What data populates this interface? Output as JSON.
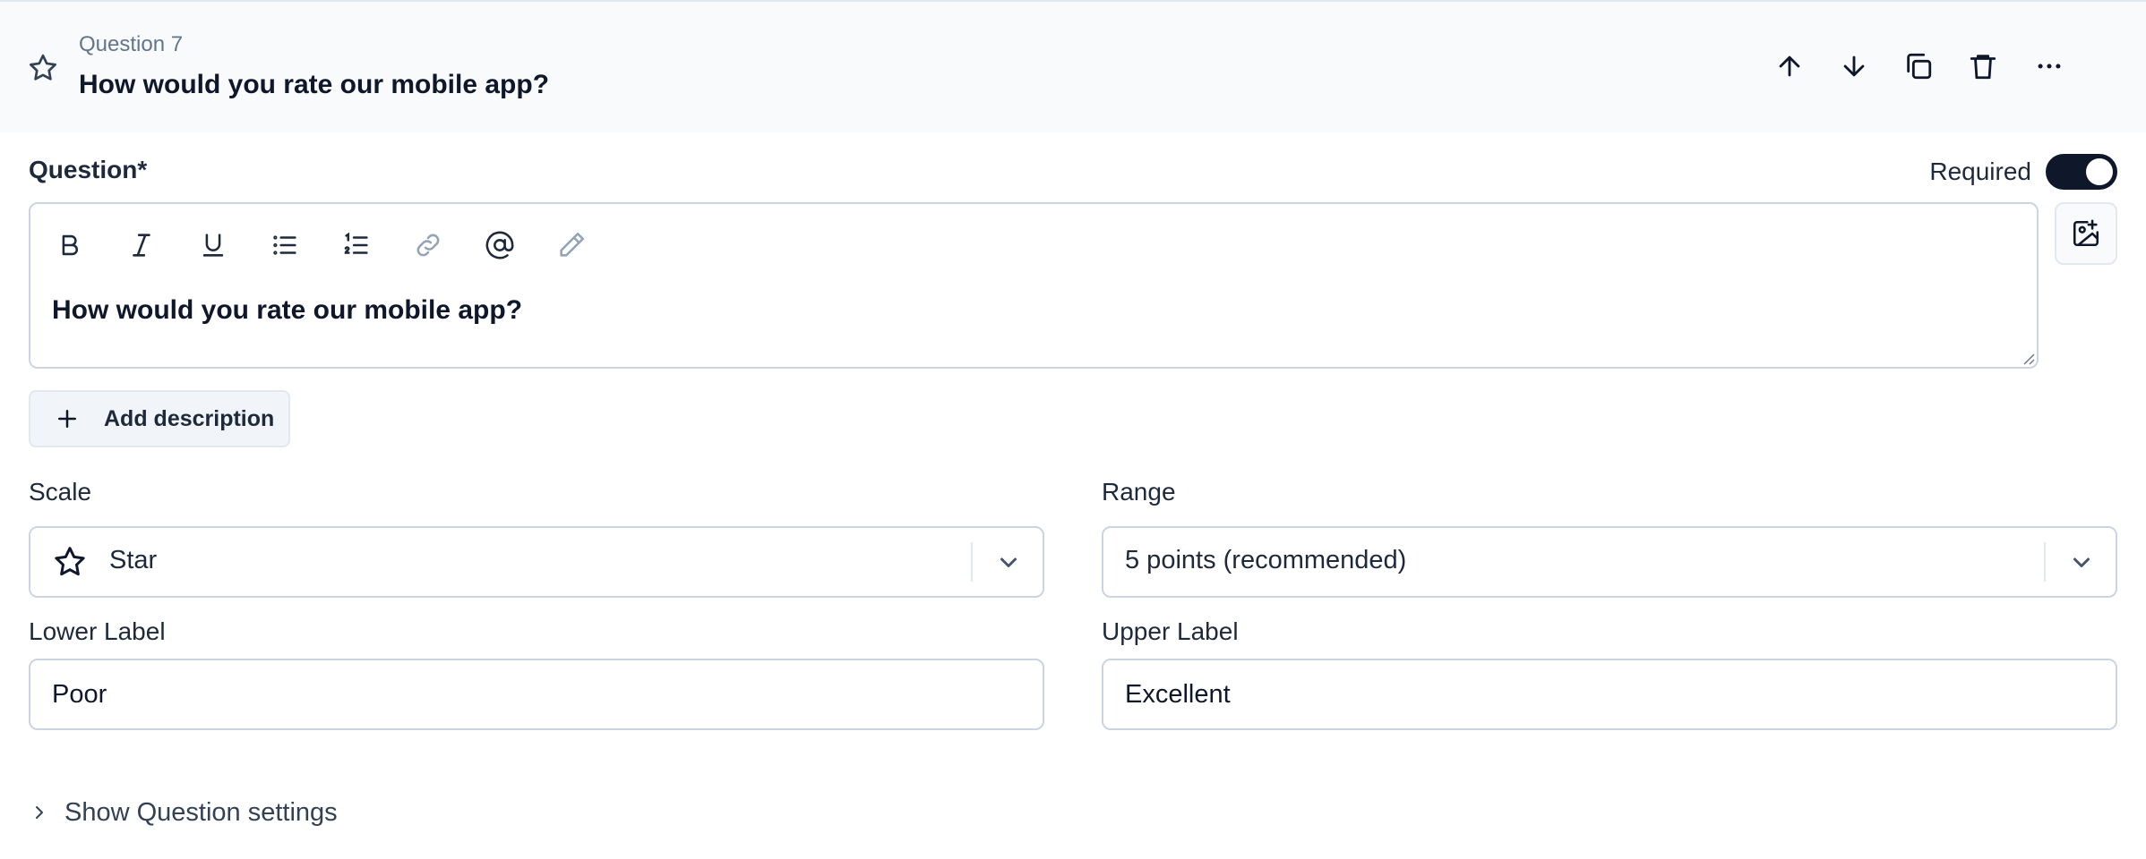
{
  "header": {
    "question_number": "Question 7",
    "title": "How would you rate our mobile app?",
    "icon": "star-icon",
    "actions": [
      "arrow-up-icon",
      "arrow-down-icon",
      "copy-icon",
      "trash-icon",
      "more-horizontal-icon"
    ]
  },
  "question": {
    "label": "Question*",
    "required_label": "Required",
    "required": true,
    "text": "How would you rate our mobile app?",
    "toolbar": [
      "bold-icon",
      "italic-icon",
      "underline-icon",
      "bullet-list-icon",
      "numbered-list-icon",
      "link-icon",
      "mention-icon",
      "pencil-icon"
    ],
    "image_button_icon": "image-plus-icon"
  },
  "add_description_label": "Add description",
  "scale": {
    "label": "Scale",
    "value": "Star",
    "icon": "star-icon"
  },
  "range": {
    "label": "Range",
    "value": "5 points (recommended)"
  },
  "lower_label": {
    "label": "Lower Label",
    "value": "Poor"
  },
  "upper_label": {
    "label": "Upper Label",
    "value": "Excellent"
  },
  "settings_toggle_label": "Show Question settings",
  "colors": {
    "header_bg": "#f8fafc",
    "toggle_on": "#0f172a",
    "border": "#cbd5e1"
  }
}
